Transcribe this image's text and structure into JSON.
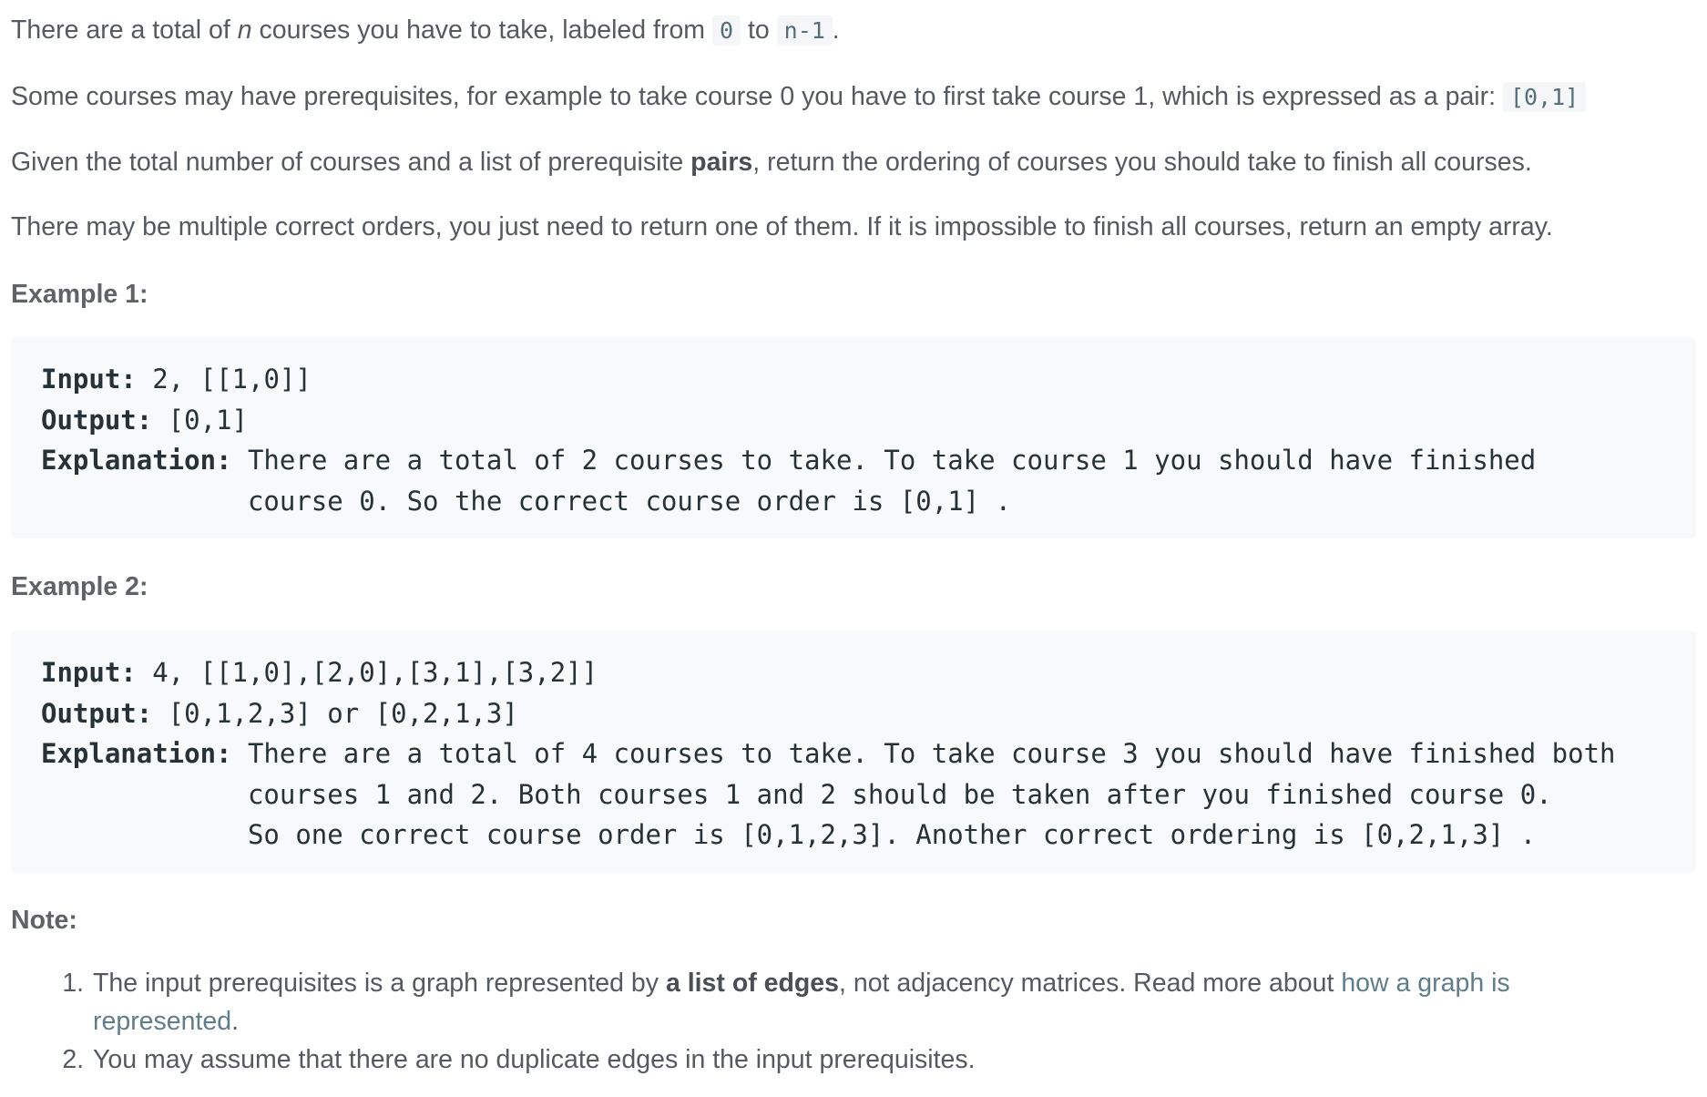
{
  "intro": {
    "p1_a": "There are a total of ",
    "p1_var": "n",
    "p1_b": " courses you have to take, labeled from ",
    "p1_code1": "0",
    "p1_c": " to ",
    "p1_code2": "n-1",
    "p1_d": ".",
    "p2_a": "Some courses may have prerequisites, for example to take course 0 you have to first take course 1, which is expressed as a pair: ",
    "p2_code": "[0,1]",
    "p3_a": "Given the total number of courses and a list of prerequisite ",
    "p3_bold": "pairs",
    "p3_b": ", return the ordering of courses you should take to finish all courses.",
    "p4": "There may be multiple correct orders, you just need to return one of them. If it is impossible to finish all courses, return an empty array."
  },
  "example1": {
    "heading": "Example 1:",
    "input_label": "Input:",
    "input_value": " 2, [[1,0]]",
    "output_label": "Output:",
    "output_value": " [0,1]",
    "explanation_label": "Explanation:",
    "explanation_value": " There are a total of 2 courses to take. To take course 1 you should have finished   \n             course 0. So the correct course order is [0,1] ."
  },
  "example2": {
    "heading": "Example 2:",
    "input_label": "Input:",
    "input_value": " 4, [[1,0],[2,0],[3,1],[3,2]]",
    "output_label": "Output:",
    "output_value": " [0,1,2,3] or [0,2,1,3]",
    "explanation_label": "Explanation:",
    "explanation_value": " There are a total of 4 courses to take. To take course 3 you should have finished both     \n             courses 1 and 2. Both courses 1 and 2 should be taken after you finished course 0. \n             So one correct course order is [0,1,2,3]. Another correct ordering is [0,2,1,3] ."
  },
  "note": {
    "heading": "Note:",
    "item1_a": "The input prerequisites is a graph represented by ",
    "item1_bold": "a list of edges",
    "item1_b": ", not adjacency matrices. Read more about ",
    "item1_link": "how a graph is represented",
    "item1_c": ".",
    "item2": "You may assume that there are no duplicate edges in the input prerequisites."
  }
}
